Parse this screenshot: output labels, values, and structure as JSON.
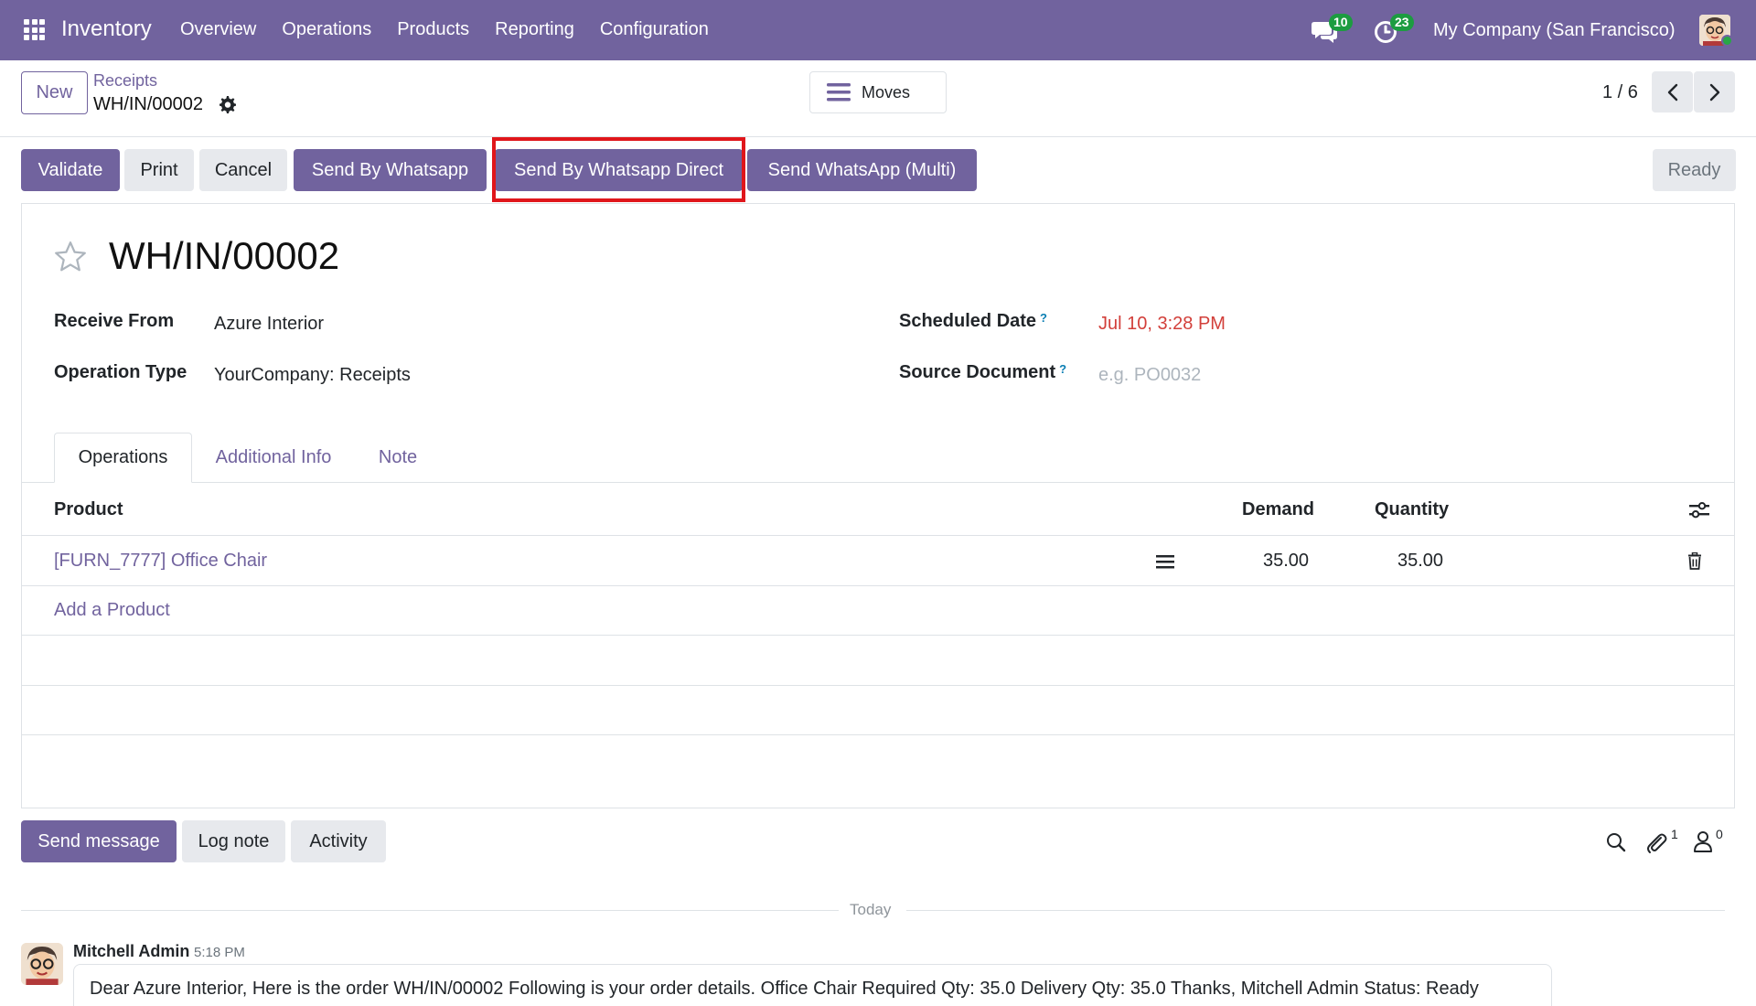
{
  "navbar": {
    "app_name": "Inventory",
    "menu": [
      "Overview",
      "Operations",
      "Products",
      "Reporting",
      "Configuration"
    ],
    "messages_count": "10",
    "activities_count": "23",
    "company": "My Company (San Francisco)",
    "bg_color": "#71639e"
  },
  "control_panel": {
    "new_label": "New",
    "breadcrumb_parent": "Receipts",
    "breadcrumb_current": "WH/IN/00002",
    "moves_label": "Moves",
    "pager": "1 / 6"
  },
  "actions": {
    "validate": "Validate",
    "print": "Print",
    "cancel": "Cancel",
    "send_whatsapp": "Send By Whatsapp",
    "send_whatsapp_direct": "Send By Whatsapp Direct",
    "send_whatsapp_multi": "Send WhatsApp (Multi)",
    "status": "Ready",
    "highlight_color": "#e0161b"
  },
  "form": {
    "title": "WH/IN/00002",
    "receive_from_label": "Receive From",
    "receive_from_value": "Azure Interior",
    "operation_type_label": "Operation Type",
    "operation_type_value": "YourCompany: Receipts",
    "scheduled_date_label": "Scheduled Date",
    "scheduled_date_value": "Jul 10, 3:28 PM",
    "source_document_label": "Source Document",
    "source_document_placeholder": "e.g. PO0032",
    "help_mark": "?"
  },
  "tabs": [
    "Operations",
    "Additional Info",
    "Note"
  ],
  "table": {
    "columns": [
      "Product",
      "Demand",
      "Quantity"
    ],
    "rows": [
      {
        "product": "[FURN_7777] Office Chair",
        "demand": "35.00",
        "quantity": "35.00"
      }
    ],
    "add_line": "Add a Product"
  },
  "chatter": {
    "send_message": "Send message",
    "log_note": "Log note",
    "activity": "Activity",
    "attachments_count": "1",
    "followers_count": "0",
    "date_separator": "Today",
    "messages": [
      {
        "author": "Mitchell Admin",
        "time": "5:18 PM",
        "body": "Dear Azure Interior, Here is the order WH/IN/00002 Following is your order details. Office Chair Required Qty: 35.0 Delivery Qty: 35.0 Thanks, Mitchell Admin Status: Ready"
      }
    ]
  }
}
